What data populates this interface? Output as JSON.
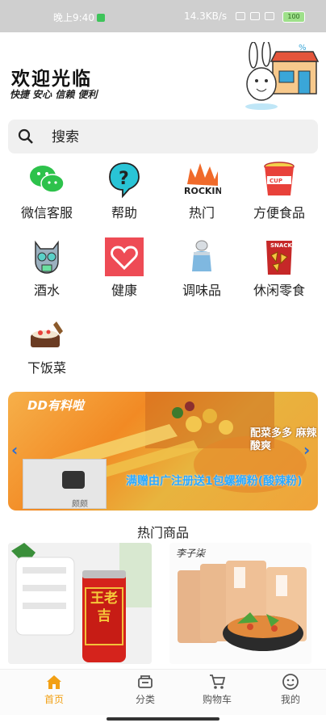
{
  "status_bar": {
    "time": "晚上9:40",
    "network_speed": "14.3KB/s",
    "battery": "100"
  },
  "header": {
    "welcome": "欢迎光临",
    "slogan": "快捷 安心 信赖 便利"
  },
  "search": {
    "placeholder": "搜索"
  },
  "categories": [
    {
      "label": "微信客服",
      "icon": "wechat-icon"
    },
    {
      "label": "帮助",
      "icon": "help-icon"
    },
    {
      "label": "热门",
      "icon": "hot-rocking-icon"
    },
    {
      "label": "方便食品",
      "icon": "instant-noodle-icon"
    },
    {
      "label": "酒水",
      "icon": "cat-bottle-icon"
    },
    {
      "label": "健康",
      "icon": "heart-icon"
    },
    {
      "label": "调味品",
      "icon": "salt-shaker-icon"
    },
    {
      "label": "休闲零食",
      "icon": "snack-bag-icon"
    },
    {
      "label": "下饭菜",
      "icon": "dish-icon"
    }
  ],
  "banner": {
    "headline": "DD有料啦",
    "side_text": "配菜多多 麻辣酸爽",
    "overlay": "满赠由广注册送1包螺狮粉(酸辣粉)",
    "video_caption": "颇颇"
  },
  "hot_section": {
    "title": "热门商品",
    "products": [
      {
        "brand_label": "王老吉"
      },
      {
        "brand_label": "李子柒"
      }
    ]
  },
  "tabbar": {
    "items": [
      {
        "label": "首页",
        "icon": "home-icon",
        "active": true
      },
      {
        "label": "分类",
        "icon": "category-icon",
        "active": false
      },
      {
        "label": "购物车",
        "icon": "cart-icon",
        "active": false
      },
      {
        "label": "我的",
        "icon": "profile-icon",
        "active": false
      }
    ]
  },
  "colors": {
    "accent": "#f2a014",
    "search_bg": "#f0f0f0"
  }
}
